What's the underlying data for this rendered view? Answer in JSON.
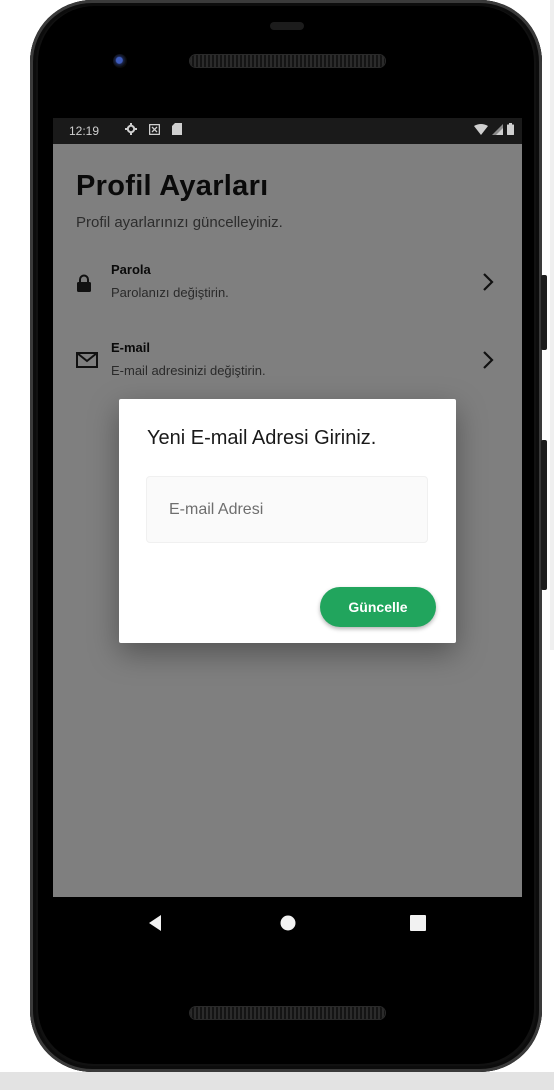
{
  "status_bar": {
    "time": "12:19",
    "left_icons": [
      "settings-icon",
      "notification-icon",
      "sd-card-icon"
    ],
    "right_icons": [
      "wifi-icon",
      "signal-icon",
      "battery-icon"
    ]
  },
  "page": {
    "title": "Profil Ayarları",
    "subtitle": "Profil ayarlarınızı güncelleyiniz."
  },
  "settings": [
    {
      "title": "Parola",
      "subtitle": "Parolanızı değiştirin.",
      "icon": "lock-icon"
    },
    {
      "title": "E-mail",
      "subtitle": "E-mail adresinizi değiştirin.",
      "icon": "mail-icon"
    }
  ],
  "dialog": {
    "title": "Yeni E-mail Adresi Giriniz.",
    "input_value": "",
    "input_placeholder": "E-mail Adresi",
    "button_label": "Güncelle",
    "button_color": "#21a55d"
  },
  "nav": {
    "back": "back-icon",
    "home": "home-icon",
    "recents": "recents-icon"
  },
  "colors": {
    "accent": "#21a55d",
    "scrim": "rgba(0,0,0,0.5)"
  }
}
